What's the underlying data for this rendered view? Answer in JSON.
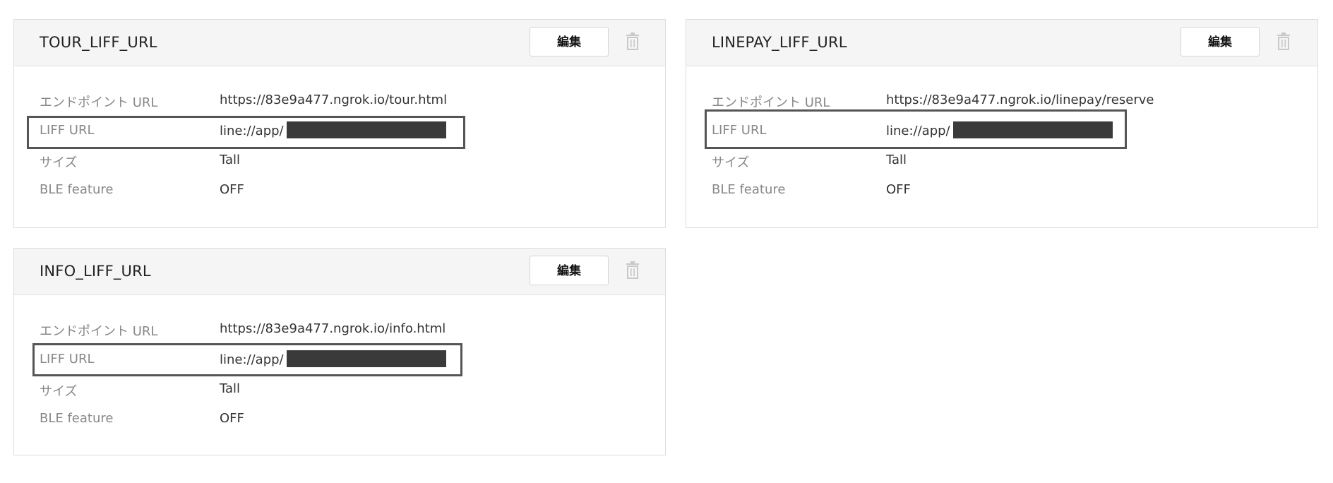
{
  "cards": [
    {
      "title": "TOUR_LIFF_URL",
      "edit_label": "編集",
      "rows": [
        {
          "label": "エンドポイント URL",
          "value": "https://83e9a477.ngrok.io/tour.html"
        },
        {
          "label": "LIFF URL",
          "value": "line://app/"
        },
        {
          "label": "サイズ",
          "value": "Tall"
        },
        {
          "label": "BLE feature",
          "value": "OFF"
        }
      ]
    },
    {
      "title": "LINEPAY_LIFF_URL",
      "edit_label": "編集",
      "rows": [
        {
          "label": "エンドポイント URL",
          "value": "https://83e9a477.ngrok.io/linepay/reserve"
        },
        {
          "label": "LIFF URL",
          "value": "line://app/"
        },
        {
          "label": "サイズ",
          "value": "Tall"
        },
        {
          "label": "BLE feature",
          "value": "OFF"
        }
      ]
    },
    {
      "title": "INFO_LIFF_URL",
      "edit_label": "編集",
      "rows": [
        {
          "label": "エンドポイント URL",
          "value": "https://83e9a477.ngrok.io/info.html"
        },
        {
          "label": "LIFF URL",
          "value": "line://app/"
        },
        {
          "label": "サイズ",
          "value": "Tall"
        },
        {
          "label": "BLE feature",
          "value": "OFF"
        }
      ]
    }
  ],
  "icons": {
    "delete": "trash-icon"
  },
  "colors": {
    "header_bg": "#f5f5f5",
    "border": "#dddddd",
    "label_text": "#888888",
    "value_text": "#333333",
    "highlight_border": "#555555",
    "redaction": "#3a3a3a"
  }
}
